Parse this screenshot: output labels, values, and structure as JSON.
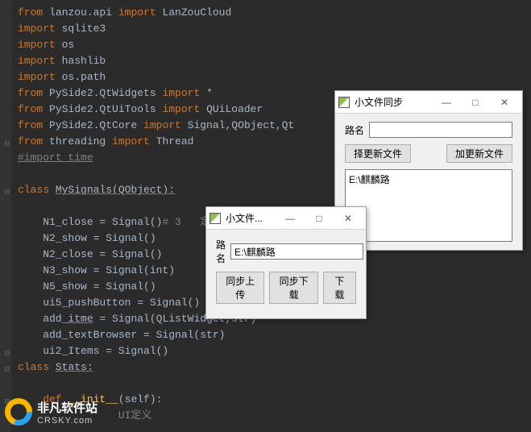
{
  "code": {
    "l1": {
      "a": "from ",
      "b": "lanzou.api ",
      "c": "import ",
      "d": "LanZouCloud"
    },
    "l2": {
      "a": "import ",
      "b": "sqlite3"
    },
    "l3": {
      "a": "import ",
      "b": "os"
    },
    "l4": {
      "a": "import ",
      "b": "hashlib"
    },
    "l5": {
      "a": "import ",
      "b": "os.path"
    },
    "l6": {
      "a": "from ",
      "b": "PySide2.QtWidgets ",
      "c": "import ",
      "d": "*"
    },
    "l7": {
      "a": "from ",
      "b": "PySide2.QtUiTools ",
      "c": "import ",
      "d": "QUiLoader"
    },
    "l8": {
      "a": "from ",
      "b": "PySide2.QtCore ",
      "c": "import ",
      "d": "Signal,QObject,Qt"
    },
    "l9": {
      "a": "from ",
      "b": "threading ",
      "c": "import ",
      "d": "Thread"
    },
    "l10": "#import time",
    "l12": {
      "a": "class ",
      "b": "MySignals(QObject):"
    },
    "l14": {
      "a": "    N1_close = Signal()",
      "cmt": "# 3   定义"
    },
    "l15": "    N2_show = Signal()",
    "l16": "    N2_close = Signal()",
    "l17": "    N3_show = Signal(int)",
    "l18": "    N5_show = Signal()",
    "l19": "    ui5_pushButton = Signal()",
    "l20": {
      "a": "    add_",
      "b": "itme",
      "c": " = Signal(QListWidget,str)"
    },
    "l21": "    add_textBrowser = Signal(str)",
    "l22": "    ui2_Items = Signal()",
    "l23": {
      "a": "class ",
      "b": "Stats:"
    },
    "l25": {
      "a": "    def ",
      "b": "__init__",
      "c": "(self):"
    },
    "l26": "                UI定义"
  },
  "dlg_small": {
    "title": "小文件...",
    "path_label": "路名",
    "path_value": "E:\\麒麟路",
    "btn_sync_upload": "同步上传",
    "btn_sync_download": "同步下载",
    "btn_download": "下载"
  },
  "dlg_large": {
    "title": "小文件同步",
    "path_label": "路名",
    "path_value": "",
    "btn_select_new": "择更新文件",
    "btn_add_new": "加更新文件",
    "list_item_0": "E:\\麒麟路"
  },
  "winctrl": {
    "min": "—",
    "max": "□",
    "close": "✕",
    "ellipsis": "..."
  },
  "watermark": {
    "line1": "非凡软件站",
    "line2": "CRSKY.com"
  }
}
